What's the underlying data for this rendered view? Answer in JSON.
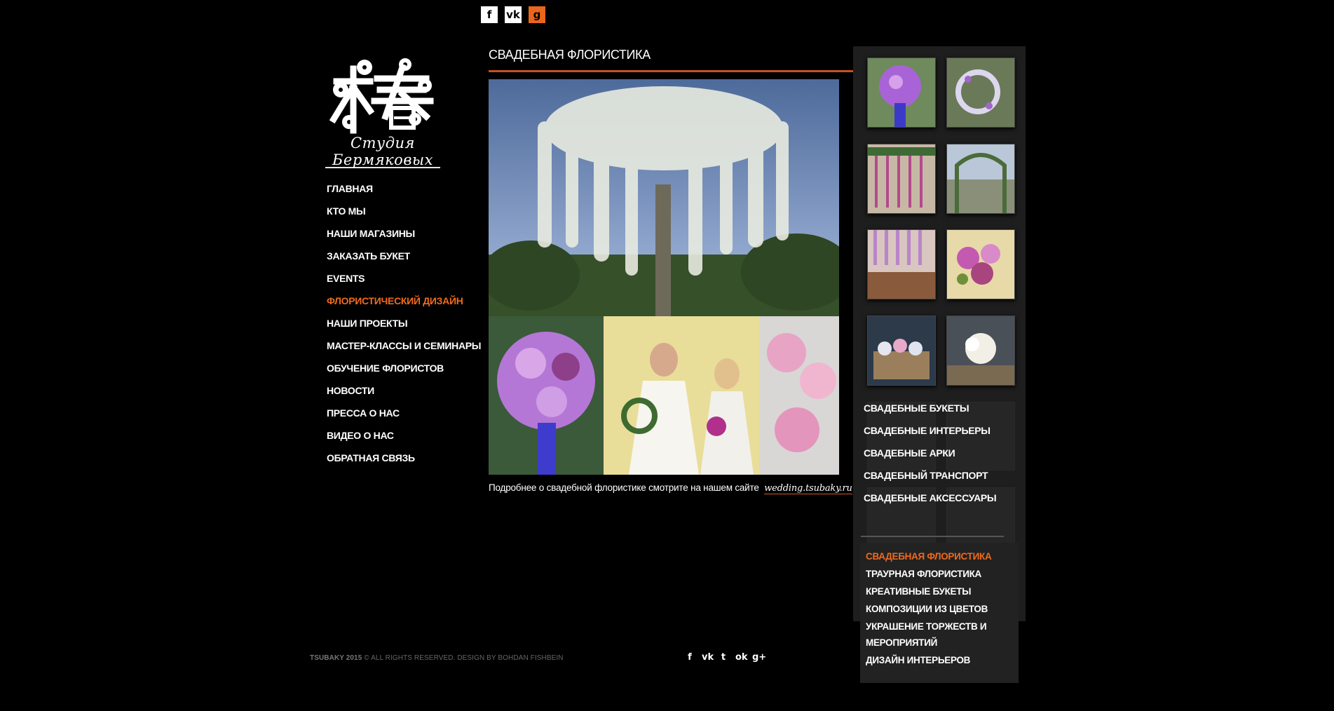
{
  "top_social": [
    {
      "icon": "facebook-icon",
      "glyph": "f"
    },
    {
      "icon": "vk-icon",
      "glyph": "vk"
    },
    {
      "icon": "odnoklassniki-icon",
      "glyph": "g"
    }
  ],
  "logo": {
    "text": "Студия Бермяковых"
  },
  "nav": [
    {
      "label": "ГЛАВНАЯ",
      "active": false
    },
    {
      "label": "КТО МЫ",
      "active": false
    },
    {
      "label": "НАШИ МАГАЗИНЫ",
      "active": false
    },
    {
      "label": "ЗАКАЗАТЬ БУКЕТ",
      "active": false
    },
    {
      "label": "EVENTS",
      "active": false
    },
    {
      "label": "ФЛОРИСТИЧЕСКИЙ ДИЗАЙН",
      "active": true
    },
    {
      "label": "НАШИ ПРОЕКТЫ",
      "active": false
    },
    {
      "label": "МАСТЕР-КЛАССЫ И СЕМИНАРЫ",
      "active": false
    },
    {
      "label": "ОБУЧЕНИЕ ФЛОРИСТОВ",
      "active": false
    },
    {
      "label": "НОВОСТИ",
      "active": false
    },
    {
      "label": "ПРЕССА О НАС",
      "active": false
    },
    {
      "label": "ВИДЕО О НАС",
      "active": false
    },
    {
      "label": "ОБРАТНАЯ СВЯЗЬ",
      "active": false
    }
  ],
  "main": {
    "title": "СВАДЕБНАЯ ФЛОРИСТИКА",
    "more_text": "Подробнее о свадебной флористике смотрите на нашем сайте",
    "more_link": "wedding.tsubaky.ru"
  },
  "categories": [
    "СВАДЕБНЫЕ БУКЕТЫ",
    "СВАДЕБНЫЕ ИНТЕРЬЕРЫ",
    "СВАДЕБНЫЕ АРКИ",
    "СВАДЕБНЫЙ ТРАНСПОРТ",
    "СВАДЕБНЫЕ АКСЕССУАРЫ"
  ],
  "submenu": [
    {
      "label": "СВАДЕБНАЯ ФЛОРИСТИКА",
      "active": true
    },
    {
      "label": "ТРАУРНАЯ ФЛОРИСТИКА",
      "active": false
    },
    {
      "label": "КРЕАТИВНЫЕ БУКЕТЫ",
      "active": false
    },
    {
      "label": "КОМПОЗИЦИИ ИЗ ЦВЕТОВ",
      "active": false
    },
    {
      "label": "УКРАШЕНИЕ ТОРЖЕСТВ И МЕРОПРИЯТИЙ",
      "active": false
    },
    {
      "label": "ДИЗАЙН ИНТЕРЬЕРОВ",
      "active": false
    }
  ],
  "footer": {
    "brand": "TSUBAKY 2015",
    "copy": "© ALL RIGHTS RESERVED. DESIGN BY BOHDAN FISHBEIN"
  },
  "footer_social": [
    {
      "icon": "facebook-icon",
      "glyph": "f"
    },
    {
      "icon": "vk-icon",
      "glyph": "vk"
    },
    {
      "icon": "twitter-icon",
      "glyph": "t"
    },
    {
      "icon": "odnoklassniki-icon",
      "glyph": "ok"
    },
    {
      "icon": "google-plus-icon",
      "glyph": "g+"
    }
  ],
  "colors": {
    "accent": "#ef6a1d",
    "background": "#000000",
    "panel": "#1e1e1e"
  }
}
